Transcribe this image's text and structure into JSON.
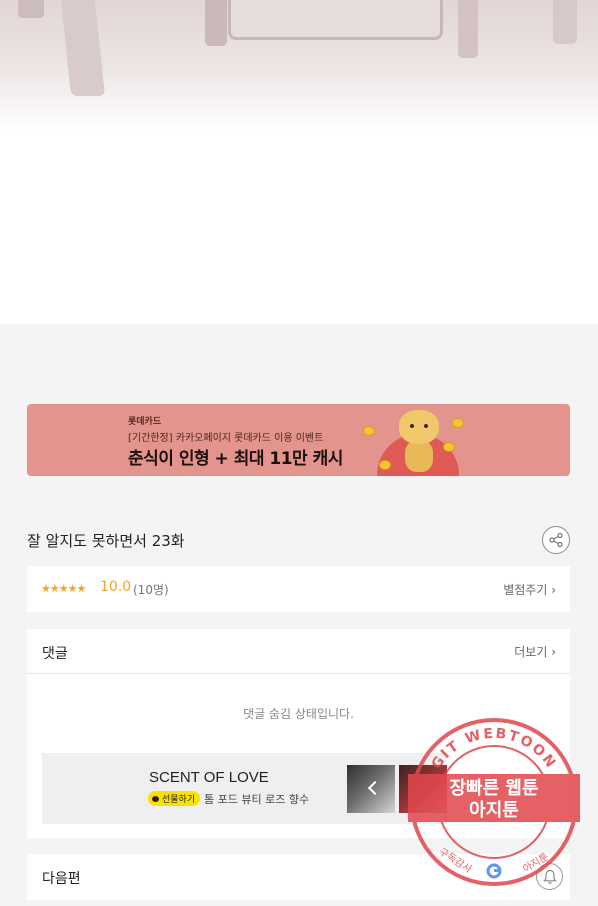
{
  "banner": {
    "brand": "롯데카드",
    "subtitle": "[기간한정] 카카오페이지 롯데카드 이용 이벤트",
    "headline": "춘식이 인형 + 최대 11만 캐시"
  },
  "episode": {
    "title": "잘 알지도 못하면서 23화"
  },
  "rating": {
    "stars": "★★★★★",
    "score": "10.0",
    "count": "(10명)",
    "rate_label": "별점주기 ›"
  },
  "comments": {
    "label": "댓글",
    "more_label": "더보기 ›",
    "hidden_message": "댓글 숨김 상태입니다."
  },
  "ad": {
    "title": "SCENT OF LOVE",
    "gift_label": "선물하기",
    "product": "톰 포드 뷰티 로즈 향수"
  },
  "next_episode": {
    "label": "다음편"
  },
  "watermark": {
    "ring_text": "GIT WEBTOON",
    "line1": "장빠른 웹툰",
    "line2": "아지툰",
    "bottom_left": "구독감사",
    "bottom_right": "아지툰"
  },
  "colors": {
    "banner_bg": "#e3948c",
    "rating_star": "#f5a623",
    "kakao_yellow": "#fbe100",
    "watermark_red": "#e0474c"
  }
}
